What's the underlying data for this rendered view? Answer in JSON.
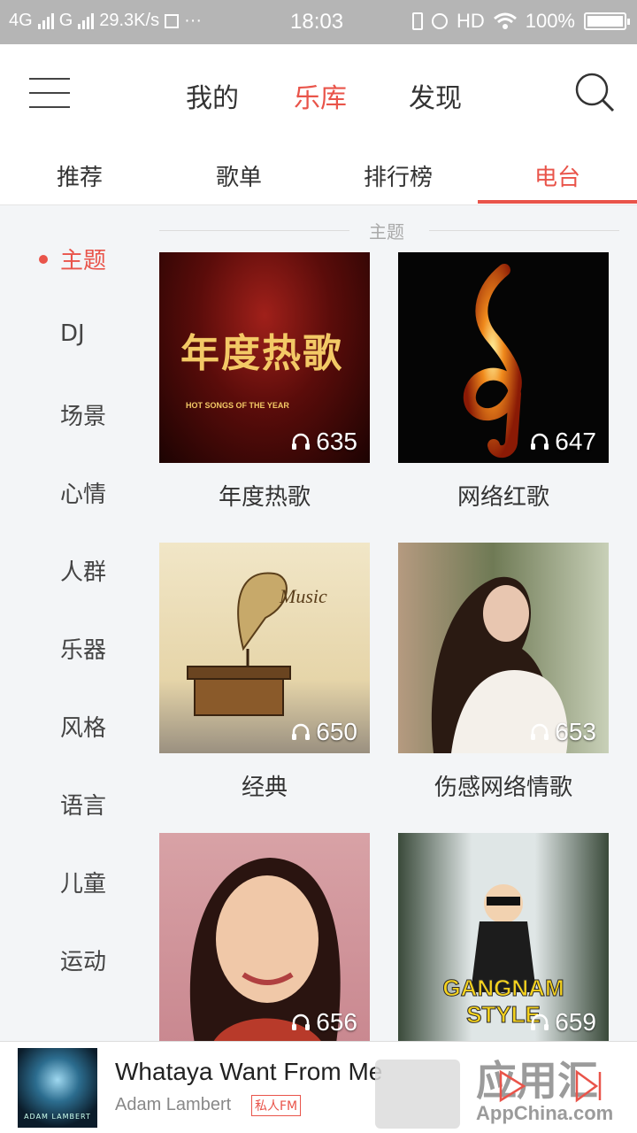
{
  "status_bar": {
    "network": "4G",
    "network2": "G",
    "speed": "29.3K/s",
    "more": "···",
    "time": "18:03",
    "hd": "HD",
    "battery": "100%"
  },
  "top_nav": {
    "tabs": [
      "我的",
      "乐库",
      "发现"
    ],
    "active": "乐库"
  },
  "sub_tabs": {
    "tabs": [
      "推荐",
      "歌单",
      "排行榜",
      "电台"
    ],
    "active": "电台"
  },
  "sidebar": {
    "items": [
      "主题",
      "DJ",
      "场景",
      "心情",
      "人群",
      "乐器",
      "风格",
      "语言",
      "儿童",
      "运动"
    ],
    "active": "主题"
  },
  "section": {
    "title": "主题"
  },
  "cards": [
    {
      "label": "年度热歌",
      "count": "635",
      "art_text": "年度热歌",
      "art_sub": "HOT SONGS OF THE YEAR"
    },
    {
      "label": "网络红歌",
      "count": "647"
    },
    {
      "label": "经典",
      "count": "650",
      "art_text": "Music"
    },
    {
      "label": "伤感网络情歌",
      "count": "653"
    },
    {
      "label": "",
      "count": "656"
    },
    {
      "label": "",
      "count": "659",
      "art_text": "GANGNAM STYLE"
    }
  ],
  "player": {
    "song": "Whataya Want From Me",
    "artist": "Adam Lambert",
    "badge": "私人FM",
    "album_text": "ADAM LAMBERT"
  },
  "watermark": {
    "cn": "应用汇",
    "en": "AppChina.com"
  },
  "colors": {
    "accent": "#e9544a",
    "background": "#f3f5f7"
  }
}
